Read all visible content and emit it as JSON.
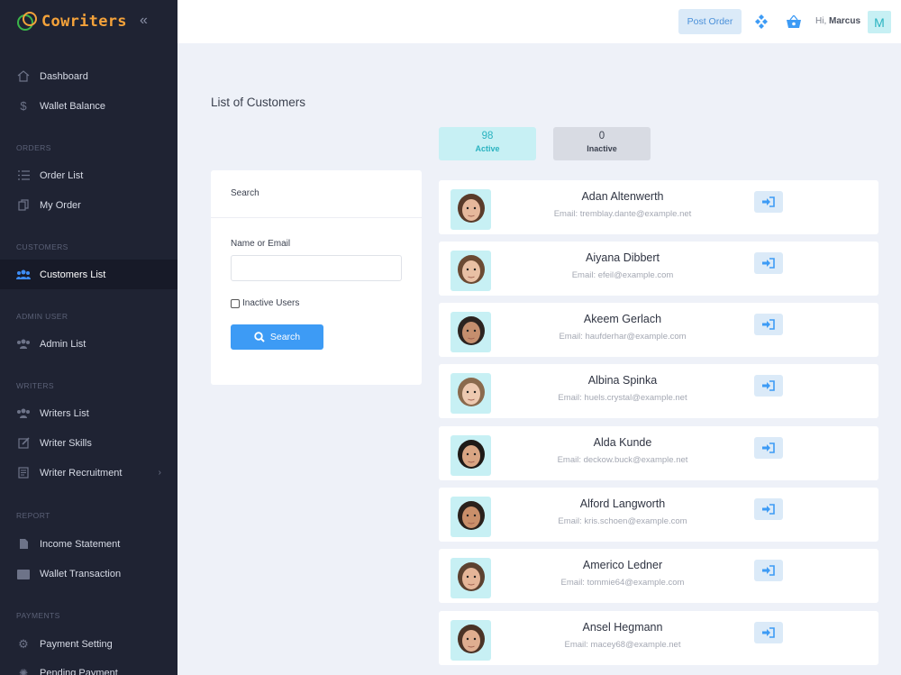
{
  "brand": {
    "name": "Cowriters"
  },
  "sidebar": {
    "items": [
      {
        "label": "Dashboard",
        "icon": "home-icon"
      },
      {
        "label": "Wallet Balance",
        "icon": "dollar-icon"
      },
      {
        "label": "Order List",
        "icon": "list-icon"
      },
      {
        "label": "My Order",
        "icon": "copy-icon"
      },
      {
        "label": "Customers List",
        "icon": "users-icon",
        "active": true
      },
      {
        "label": "Admin List",
        "icon": "users-icon"
      },
      {
        "label": "Writers List",
        "icon": "users-icon"
      },
      {
        "label": "Writer Skills",
        "icon": "edit-icon"
      },
      {
        "label": "Writer Recruitment",
        "icon": "document-icon"
      },
      {
        "label": "Income Statement",
        "icon": "file-icon"
      },
      {
        "label": "Wallet Transaction",
        "icon": "wallet-icon"
      },
      {
        "label": "Payment Setting",
        "icon": "gear-icon"
      },
      {
        "label": "Pending Payment",
        "icon": "spinner-icon"
      }
    ],
    "captions": [
      "ORDERS",
      "CUSTOMERS",
      "ADMIN USER",
      "WRITERS",
      "REPORT",
      "PAYMENTS"
    ]
  },
  "header": {
    "post_order": "Post Order",
    "greeting": "Hi,",
    "user_name": "Marcus",
    "avatar_initial": "M"
  },
  "main": {
    "title": "List of Customers",
    "stats": {
      "active_count": "98",
      "active_label": "Active",
      "inactive_count": "0",
      "inactive_label": "Inactive"
    },
    "search": {
      "title": "Search",
      "field_label": "Name or Email",
      "field_value": "",
      "checkbox_label": "Inactive Users",
      "button_label": "Search"
    },
    "customers": [
      {
        "name": "Adan Altenwerth",
        "email": "Email: tremblay.dante@example.net"
      },
      {
        "name": "Aiyana Dibbert",
        "email": "Email: efeil@example.com"
      },
      {
        "name": "Akeem Gerlach",
        "email": "Email: haufderhar@example.com"
      },
      {
        "name": "Albina Spinka",
        "email": "Email: huels.crystal@example.net"
      },
      {
        "name": "Alda Kunde",
        "email": "Email: deckow.buck@example.net"
      },
      {
        "name": "Alford Langworth",
        "email": "Email: kris.schoen@example.com"
      },
      {
        "name": "Americo Ledner",
        "email": "Email: tommie64@example.com"
      },
      {
        "name": "Ansel Hegmann",
        "email": "Email: macey68@example.net"
      }
    ]
  },
  "colors": {
    "sidebar_bg": "#1f2333",
    "accent_blue": "#3d9bf5",
    "accent_cyan": "#2ab3c0",
    "brand_orange": "#f4a23a",
    "page_bg": "#eef1f8"
  }
}
